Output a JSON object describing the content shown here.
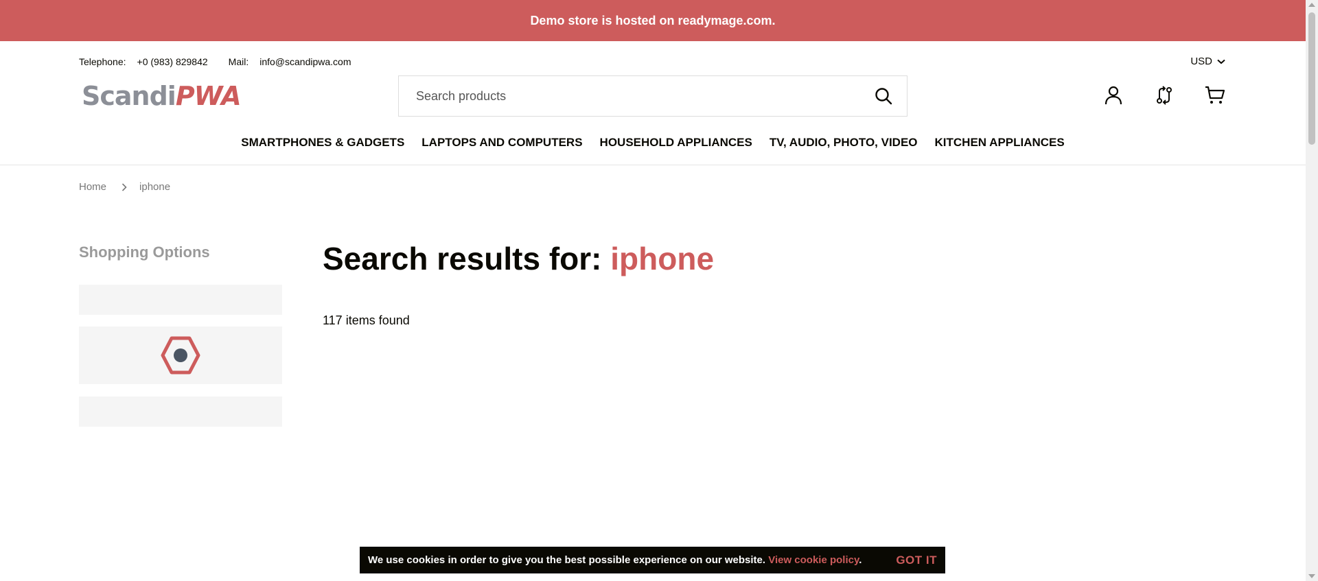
{
  "banner": {
    "text": "Demo store is hosted on readymage.com."
  },
  "contact": {
    "telephone_label": "Telephone:",
    "telephone_value": "+0 (983) 829842",
    "mail_label": "Mail:",
    "mail_value": "info@scandipwa.com"
  },
  "currency": {
    "selected": "USD",
    "icon": "chevron-down-icon"
  },
  "logo": {
    "part1": "Scandi",
    "part2": "PWA"
  },
  "search": {
    "placeholder": "Search products",
    "value": "",
    "icon": "search-icon"
  },
  "header_icons": [
    "account-icon",
    "compare-icon",
    "cart-icon"
  ],
  "menu": {
    "items": [
      {
        "label": "Smartphones & Gadgets"
      },
      {
        "label": "Laptops and Computers"
      },
      {
        "label": "Household Appliances"
      },
      {
        "label": "TV, Audio, Photo, Video"
      },
      {
        "label": "Kitchen Appliances"
      }
    ]
  },
  "breadcrumbs": {
    "home": "Home",
    "current": "iphone"
  },
  "sidebar": {
    "title": "Shopping Options",
    "loader_icon": "loader-icon"
  },
  "results": {
    "title_prefix": "Search results for:",
    "term": "iphone",
    "count_text": "117 items found"
  },
  "cookie": {
    "text": "We use cookies in order to give you the best possible experience on our website.",
    "link": "View cookie policy",
    "suffix": ".",
    "button": "GOT IT"
  },
  "colors": {
    "brand": "#cd5c5c",
    "text": "#0a0903",
    "muted": "#9a9a9a",
    "placeholder_bg": "#f5f5f5"
  }
}
